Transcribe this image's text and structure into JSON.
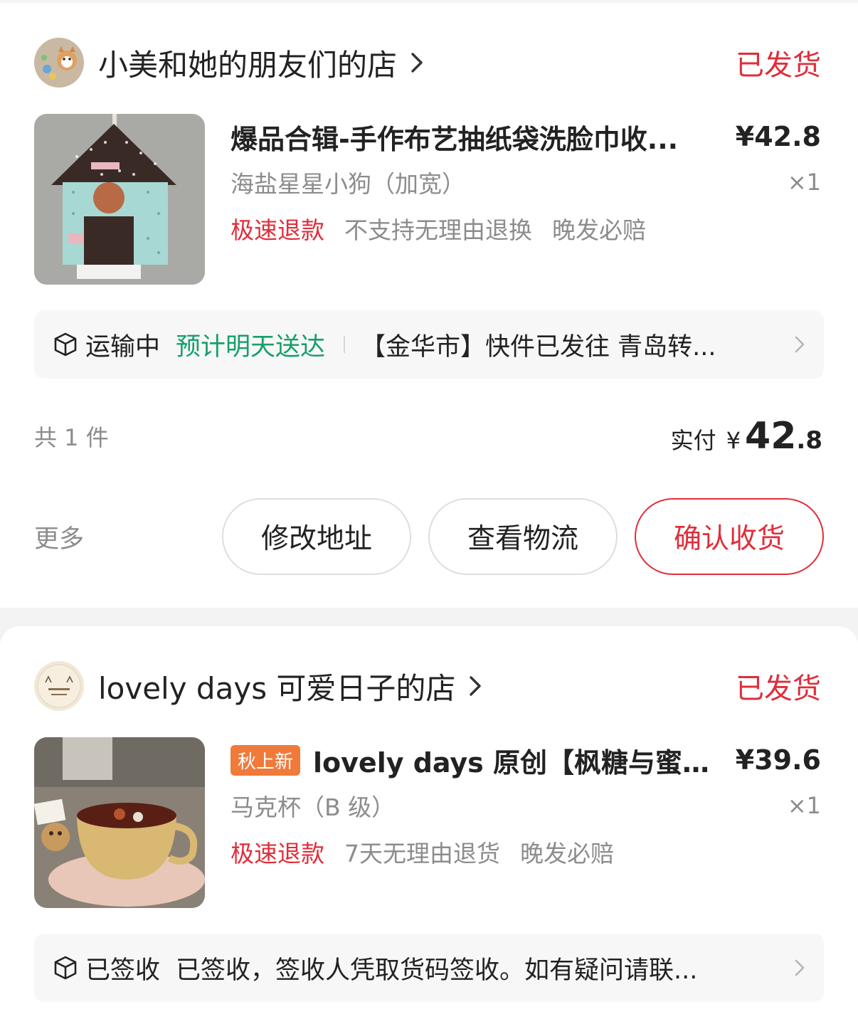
{
  "orders": [
    {
      "shop_name": "小美和她的朋友们的店",
      "status": "已发货",
      "product": {
        "title": "爆品合辑-手作布艺抽纸袋洗脸巾收...",
        "price": "¥42.8",
        "spec": "海盐星星小狗（加宽）",
        "qty": "×1",
        "services": [
          "极速退款",
          "不支持无理由退换",
          "晚发必赔"
        ]
      },
      "logistics": {
        "state": "运输中",
        "eta": "预计明天送达",
        "text": "【金华市】快件已发往 青岛转..."
      },
      "count": "共 1 件",
      "paid_label": "实付",
      "paid_currency": "¥",
      "paid_int": "42",
      "paid_dec": ".8",
      "more": "更多",
      "buttons": [
        "修改地址",
        "查看物流",
        "确认收货"
      ]
    },
    {
      "shop_name": "lovely days 可爱日子的店",
      "status": "已发货",
      "product": {
        "tag": "秋上新",
        "title": "lovely days 原创【枫糖与蜜】...",
        "price": "¥39.6",
        "spec": "马克杯（B 级）",
        "qty": "×1",
        "services": [
          "极速退款",
          "7天无理由退货",
          "晚发必赔"
        ]
      },
      "logistics": {
        "state": "已签收",
        "text": "已签收，签收人凭取货码签收。如有疑问请联..."
      }
    }
  ],
  "colors": {
    "accent_red": "#e02e3b",
    "eta_green": "#15a06a",
    "tag_orange": "#f07a3a",
    "muted_gray": "#8c8c8c"
  }
}
